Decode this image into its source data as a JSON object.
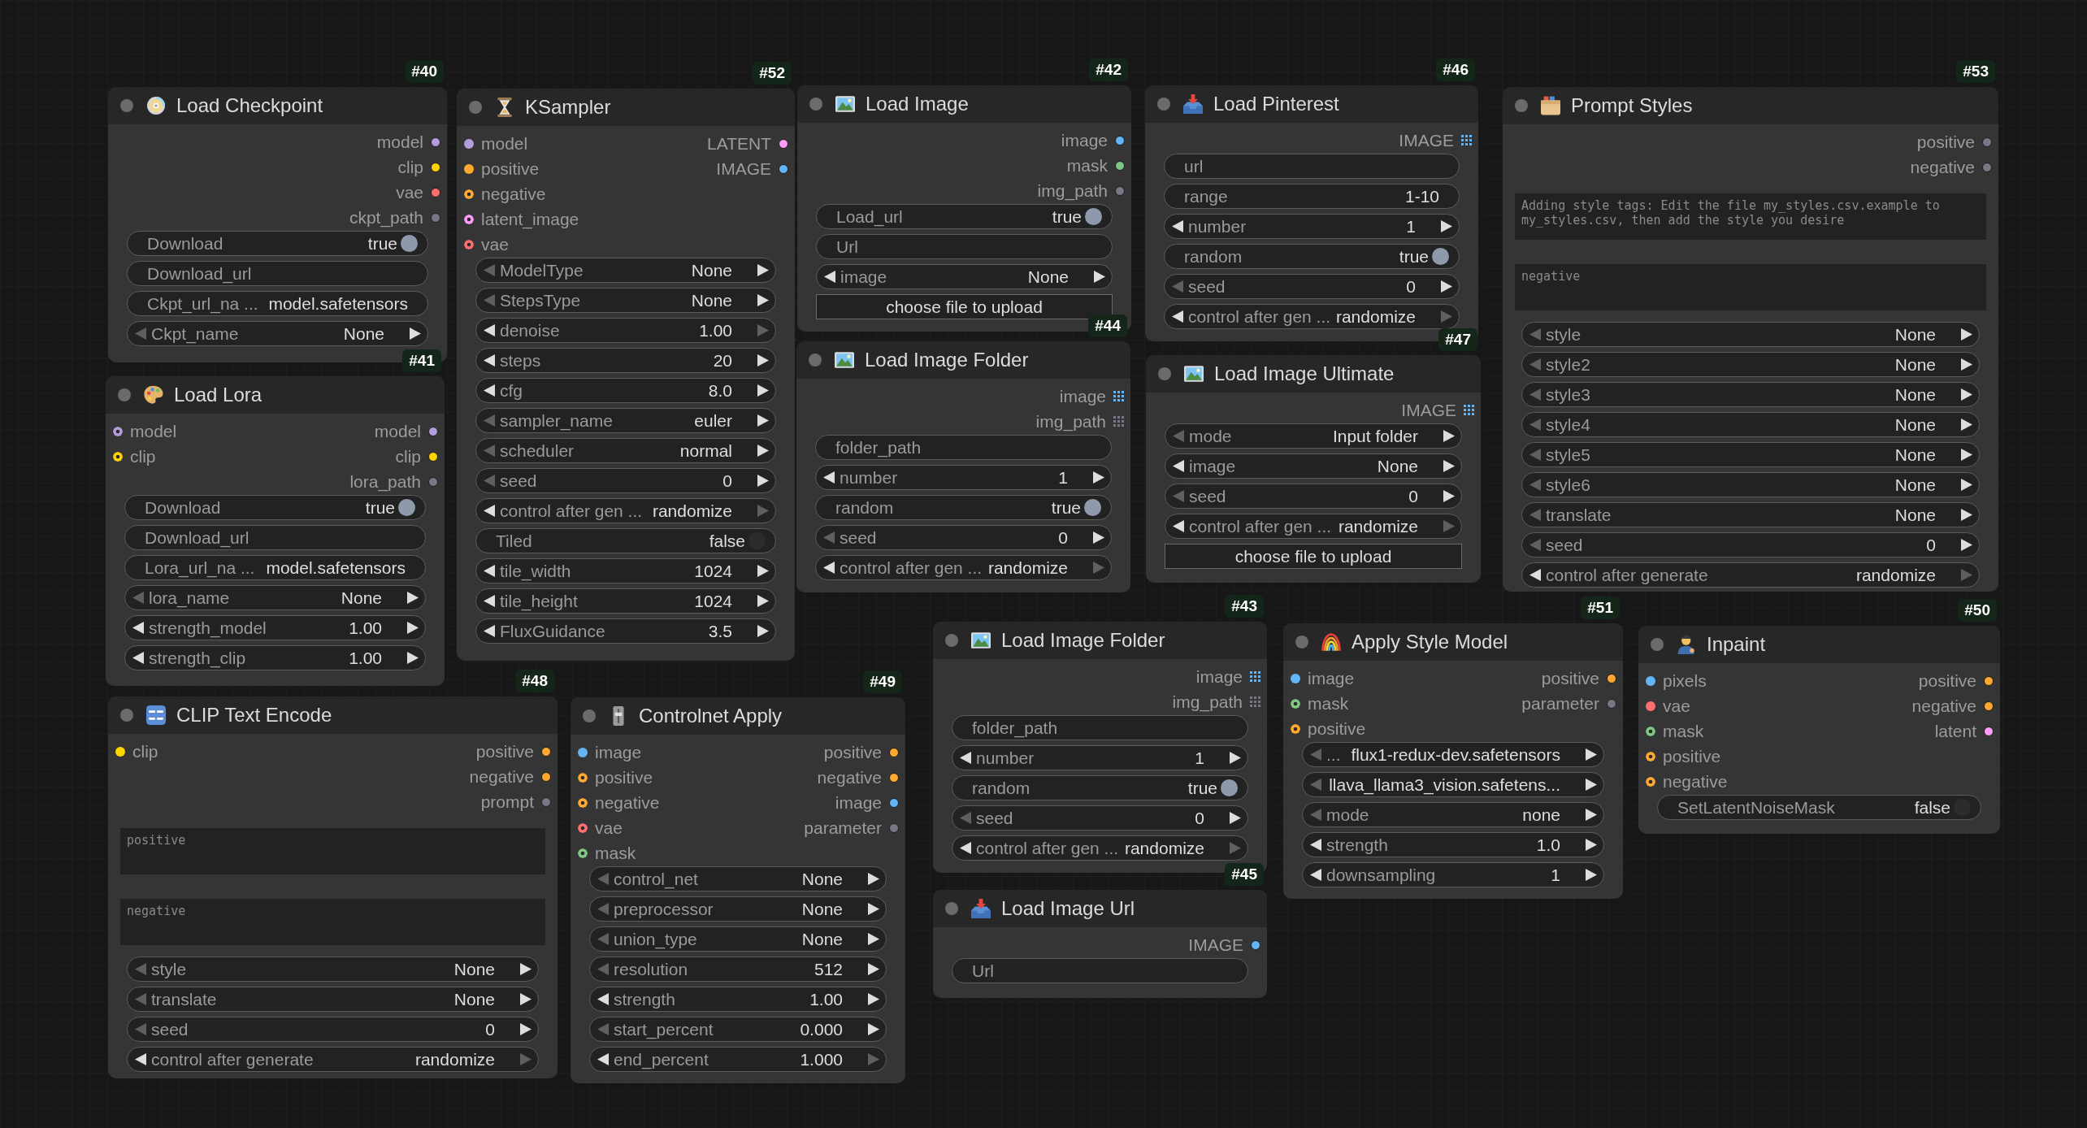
{
  "nodes": [
    {
      "badge": "#40",
      "title": "Load Checkpoint",
      "outputs": [
        {
          "label": "model",
          "kind": "dot",
          "color": "#b39ddb"
        },
        {
          "label": "clip",
          "kind": "dot",
          "color": "#ffd500"
        },
        {
          "label": "vae",
          "kind": "dot",
          "color": "#ff6e6e"
        },
        {
          "label": "ckpt_path",
          "kind": "dot",
          "color": "#777788"
        }
      ],
      "widgets": [
        {
          "kind": "toggle",
          "label": "Download",
          "value": "true",
          "on": true
        },
        {
          "kind": "text",
          "label": "Download_url"
        },
        {
          "kind": "text",
          "label": "Ckpt_url_na ...",
          "value": "model.safetensors"
        },
        {
          "kind": "combo",
          "label": "Ckpt_name",
          "value": "None",
          "left_disabled": true,
          "right_disabled": false
        }
      ]
    },
    {
      "badge": "#52",
      "title": "KSampler",
      "inputs": [
        {
          "label": "model",
          "kind": "dot",
          "color": "#b39ddb"
        },
        {
          "label": "positive",
          "kind": "dot",
          "color": "#ffa931"
        },
        {
          "label": "negative",
          "kind": "ring",
          "color": "#ffa931"
        },
        {
          "label": "latent_image",
          "kind": "ring",
          "color": "#ff9cf9"
        },
        {
          "label": "vae",
          "kind": "ring",
          "color": "#ff6e6e"
        }
      ],
      "outputs": [
        {
          "label": "LATENT",
          "kind": "dot",
          "color": "#ff9cf9"
        },
        {
          "label": "IMAGE",
          "kind": "dot",
          "color": "#64b5f6"
        }
      ],
      "widgets": [
        {
          "kind": "combo",
          "label": "ModelType",
          "value": "None",
          "left_disabled": true,
          "right_disabled": false
        },
        {
          "kind": "combo",
          "label": "StepsType",
          "value": "None",
          "left_disabled": true,
          "right_disabled": false
        },
        {
          "kind": "combo",
          "label": "denoise",
          "value": "1.00",
          "left_disabled": false,
          "right_disabled": true
        },
        {
          "kind": "combo",
          "label": "steps",
          "value": "20",
          "left_disabled": false,
          "right_disabled": false
        },
        {
          "kind": "combo",
          "label": "cfg",
          "value": "8.0",
          "left_disabled": false,
          "right_disabled": false
        },
        {
          "kind": "combo",
          "label": "sampler_name",
          "value": "euler",
          "left_disabled": true,
          "right_disabled": false
        },
        {
          "kind": "combo",
          "label": "scheduler",
          "value": "normal",
          "left_disabled": true,
          "right_disabled": false
        },
        {
          "kind": "combo",
          "label": "seed",
          "value": "0",
          "left_disabled": true,
          "right_disabled": false
        },
        {
          "kind": "combo",
          "label": "control after gen ...",
          "value": "randomize",
          "left_disabled": false,
          "right_disabled": true
        },
        {
          "kind": "toggle",
          "label": "Tiled",
          "value": "false",
          "on": false
        },
        {
          "kind": "combo",
          "label": "tile_width",
          "value": "1024",
          "left_disabled": false,
          "right_disabled": false
        },
        {
          "kind": "combo",
          "label": "tile_height",
          "value": "1024",
          "left_disabled": false,
          "right_disabled": false
        },
        {
          "kind": "combo",
          "label": "FluxGuidance",
          "value": "3.5",
          "left_disabled": false,
          "right_disabled": false
        }
      ]
    },
    {
      "badge": "#41",
      "title": "Load Lora",
      "inputs": [
        {
          "label": "model",
          "kind": "ring",
          "color": "#b39ddb"
        },
        {
          "label": "clip",
          "kind": "ring",
          "color": "#ffd500"
        }
      ],
      "outputs": [
        {
          "label": "model",
          "kind": "dot",
          "color": "#b39ddb"
        },
        {
          "label": "clip",
          "kind": "dot",
          "color": "#ffd500"
        },
        {
          "label": "lora_path",
          "kind": "dot",
          "color": "#777788"
        }
      ],
      "widgets": [
        {
          "kind": "toggle",
          "label": "Download",
          "value": "true",
          "on": true
        },
        {
          "kind": "text",
          "label": "Download_url"
        },
        {
          "kind": "text",
          "label": "Lora_url_na ...",
          "value": "model.safetensors"
        },
        {
          "kind": "combo",
          "label": "lora_name",
          "value": "None",
          "left_disabled": true,
          "right_disabled": false
        },
        {
          "kind": "combo",
          "label": "strength_model",
          "value": "1.00",
          "left_disabled": false,
          "right_disabled": false
        },
        {
          "kind": "combo",
          "label": "strength_clip",
          "value": "1.00",
          "left_disabled": false,
          "right_disabled": false
        }
      ]
    },
    {
      "badge": "#42",
      "title": "Load Image",
      "outputs": [
        {
          "label": "image",
          "kind": "dot",
          "color": "#64b5f6"
        },
        {
          "label": "mask",
          "kind": "dot",
          "color": "#81c784"
        },
        {
          "label": "img_path",
          "kind": "dot",
          "color": "#777788"
        }
      ],
      "widgets": [
        {
          "kind": "toggle",
          "label": "Load_url",
          "value": "true",
          "on": true
        },
        {
          "kind": "text",
          "label": "Url"
        },
        {
          "kind": "combo",
          "label": "image",
          "value": "None",
          "left_disabled": false,
          "right_disabled": false
        },
        {
          "kind": "button",
          "label": "choose file to upload"
        }
      ]
    },
    {
      "badge": "#44",
      "title": "Load Image Folder",
      "outputs": [
        {
          "label": "image",
          "kind": "grid",
          "color": "#64b5f6"
        },
        {
          "label": "img_path",
          "kind": "grid",
          "color": "#777788"
        }
      ],
      "widgets": [
        {
          "kind": "text",
          "label": "folder_path"
        },
        {
          "kind": "combo",
          "label": "number",
          "value": "1",
          "left_disabled": false,
          "right_disabled": false
        },
        {
          "kind": "toggle",
          "label": "random",
          "value": "true",
          "on": true
        },
        {
          "kind": "combo",
          "label": "seed",
          "value": "0",
          "left_disabled": true,
          "right_disabled": false
        },
        {
          "kind": "combo",
          "label": "control after gen ...",
          "value": "randomize",
          "left_disabled": false,
          "right_disabled": true
        }
      ]
    },
    {
      "badge": "#46",
      "title": "Load Pinterest",
      "outputs": [
        {
          "label": "IMAGE",
          "kind": "grid",
          "color": "#64b5f6"
        }
      ],
      "widgets": [
        {
          "kind": "text",
          "label": "url"
        },
        {
          "kind": "text",
          "label": "range",
          "value": "1-10"
        },
        {
          "kind": "combo",
          "label": "number",
          "value": "1",
          "left_disabled": false,
          "right_disabled": false
        },
        {
          "kind": "toggle",
          "label": "random",
          "value": "true",
          "on": true
        },
        {
          "kind": "combo",
          "label": "seed",
          "value": "0",
          "left_disabled": true,
          "right_disabled": false
        },
        {
          "kind": "combo",
          "label": "control after gen ...",
          "value": "randomize",
          "left_disabled": false,
          "right_disabled": true
        }
      ]
    },
    {
      "badge": "#47",
      "title": "Load Image Ultimate",
      "outputs": [
        {
          "label": "IMAGE",
          "kind": "grid",
          "color": "#64b5f6"
        }
      ],
      "widgets": [
        {
          "kind": "combo",
          "label": "mode",
          "value": "Input folder",
          "left_disabled": true,
          "right_disabled": false
        },
        {
          "kind": "combo",
          "label": "image",
          "value": "None",
          "left_disabled": false,
          "right_disabled": false
        },
        {
          "kind": "combo",
          "label": "seed",
          "value": "0",
          "left_disabled": true,
          "right_disabled": false
        },
        {
          "kind": "combo",
          "label": "control after gen ...",
          "value": "randomize",
          "left_disabled": false,
          "right_disabled": true
        },
        {
          "kind": "button",
          "label": "choose file to upload"
        }
      ]
    },
    {
      "badge": "#53",
      "title": "Prompt Styles",
      "outputs": [
        {
          "label": "positive",
          "kind": "dot",
          "color": "#777788"
        },
        {
          "label": "negative",
          "kind": "dot",
          "color": "#777788"
        }
      ],
      "widgets": [
        {
          "kind": "textarea",
          "placeholder": "Adding style tags: Edit the file my_styles.csv.example to my_styles.csv, then add the style you desire"
        },
        {
          "kind": "textarea",
          "placeholder": "negative"
        },
        {
          "kind": "combo",
          "label": "style",
          "value": "None",
          "left_disabled": true,
          "right_disabled": false
        },
        {
          "kind": "combo",
          "label": "style2",
          "value": "None",
          "left_disabled": true,
          "right_disabled": false
        },
        {
          "kind": "combo",
          "label": "style3",
          "value": "None",
          "left_disabled": true,
          "right_disabled": false
        },
        {
          "kind": "combo",
          "label": "style4",
          "value": "None",
          "left_disabled": true,
          "right_disabled": false
        },
        {
          "kind": "combo",
          "label": "style5",
          "value": "None",
          "left_disabled": true,
          "right_disabled": false
        },
        {
          "kind": "combo",
          "label": "style6",
          "value": "None",
          "left_disabled": true,
          "right_disabled": false
        },
        {
          "kind": "combo",
          "label": "translate",
          "value": "None",
          "left_disabled": true,
          "right_disabled": false
        },
        {
          "kind": "combo",
          "label": "seed",
          "value": "0",
          "left_disabled": true,
          "right_disabled": false
        },
        {
          "kind": "combo",
          "label": "control after generate",
          "value": "randomize",
          "left_disabled": false,
          "right_disabled": true
        }
      ]
    },
    {
      "badge": "#48",
      "title": "CLIP Text Encode",
      "inputs": [
        {
          "label": "clip",
          "kind": "dot",
          "color": "#ffd500"
        }
      ],
      "outputs": [
        {
          "label": "positive",
          "kind": "dot",
          "color": "#ffa931"
        },
        {
          "label": "negative",
          "kind": "dot",
          "color": "#ffa931"
        },
        {
          "label": "prompt",
          "kind": "dot",
          "color": "#777788"
        }
      ],
      "widgets": [
        {
          "kind": "textarea",
          "placeholder": "positive"
        },
        {
          "kind": "textarea",
          "placeholder": "negative"
        },
        {
          "kind": "combo",
          "label": "style",
          "value": "None",
          "left_disabled": true,
          "right_disabled": false
        },
        {
          "kind": "combo",
          "label": "translate",
          "value": "None",
          "left_disabled": true,
          "right_disabled": false
        },
        {
          "kind": "combo",
          "label": "seed",
          "value": "0",
          "left_disabled": true,
          "right_disabled": false
        },
        {
          "kind": "combo",
          "label": "control after generate",
          "value": "randomize",
          "left_disabled": false,
          "right_disabled": true
        }
      ]
    },
    {
      "badge": "#49",
      "title": "Controlnet Apply",
      "inputs": [
        {
          "label": "image",
          "kind": "dot",
          "color": "#64b5f6"
        },
        {
          "label": "positive",
          "kind": "ring",
          "color": "#ffa931"
        },
        {
          "label": "negative",
          "kind": "ring",
          "color": "#ffa931"
        },
        {
          "label": "vae",
          "kind": "ring",
          "color": "#ff6e6e"
        },
        {
          "label": "mask",
          "kind": "ring",
          "color": "#81c784"
        }
      ],
      "outputs": [
        {
          "label": "positive",
          "kind": "dot",
          "color": "#ffa931"
        },
        {
          "label": "negative",
          "kind": "dot",
          "color": "#ffa931"
        },
        {
          "label": "image",
          "kind": "dot",
          "color": "#64b5f6"
        },
        {
          "label": "parameter",
          "kind": "dot",
          "color": "#777788"
        }
      ],
      "widgets": [
        {
          "kind": "combo",
          "label": "control_net",
          "value": "None",
          "left_disabled": true,
          "right_disabled": false
        },
        {
          "kind": "combo",
          "label": "preprocessor",
          "value": "None",
          "left_disabled": true,
          "right_disabled": false
        },
        {
          "kind": "combo",
          "label": "union_type",
          "value": "None",
          "left_disabled": true,
          "right_disabled": false
        },
        {
          "kind": "combo",
          "label": "resolution",
          "value": "512",
          "left_disabled": true,
          "right_disabled": false
        },
        {
          "kind": "combo",
          "label": "strength",
          "value": "1.00",
          "left_disabled": false,
          "right_disabled": false
        },
        {
          "kind": "combo",
          "label": "start_percent",
          "value": "0.000",
          "left_disabled": true,
          "right_disabled": false
        },
        {
          "kind": "combo",
          "label": "end_percent",
          "value": "1.000",
          "left_disabled": false,
          "right_disabled": true
        }
      ]
    },
    {
      "badge": "#43",
      "title": "Load Image Folder",
      "outputs": [
        {
          "label": "image",
          "kind": "grid",
          "color": "#64b5f6"
        },
        {
          "label": "img_path",
          "kind": "grid",
          "color": "#777788"
        }
      ],
      "widgets": [
        {
          "kind": "text",
          "label": "folder_path"
        },
        {
          "kind": "combo",
          "label": "number",
          "value": "1",
          "left_disabled": false,
          "right_disabled": false
        },
        {
          "kind": "toggle",
          "label": "random",
          "value": "true",
          "on": true
        },
        {
          "kind": "combo",
          "label": "seed",
          "value": "0",
          "left_disabled": true,
          "right_disabled": false
        },
        {
          "kind": "combo",
          "label": "control after gen ...",
          "value": "randomize",
          "left_disabled": false,
          "right_disabled": true
        }
      ]
    },
    {
      "badge": "#45",
      "title": "Load Image Url",
      "outputs": [
        {
          "label": "IMAGE",
          "kind": "dot",
          "color": "#64b5f6"
        }
      ],
      "widgets": [
        {
          "kind": "text",
          "label": "Url"
        }
      ]
    },
    {
      "badge": "#51",
      "title": "Apply Style Model",
      "inputs": [
        {
          "label": "image",
          "kind": "dot",
          "color": "#64b5f6"
        },
        {
          "label": "mask",
          "kind": "ring",
          "color": "#81c784"
        },
        {
          "label": "positive",
          "kind": "ring",
          "color": "#ffa931"
        }
      ],
      "outputs": [
        {
          "label": "positive",
          "kind": "dot",
          "color": "#ffa931"
        },
        {
          "label": "parameter",
          "kind": "dot",
          "color": "#777788"
        }
      ],
      "widgets": [
        {
          "kind": "combo",
          "label": "...",
          "value": "flux1-redux-dev.safetensors",
          "left_disabled": true,
          "right_disabled": false
        },
        {
          "kind": "combo",
          "value": "llava_llama3_vision.safetens...",
          "left_disabled": true,
          "right_disabled": false
        },
        {
          "kind": "combo",
          "label": "mode",
          "value": "none",
          "left_disabled": true,
          "right_disabled": false
        },
        {
          "kind": "combo",
          "label": "strength",
          "value": "1.0",
          "left_disabled": false,
          "right_disabled": false
        },
        {
          "kind": "combo",
          "label": "downsampling",
          "value": "1",
          "left_disabled": false,
          "right_disabled": false
        }
      ]
    },
    {
      "badge": "#50",
      "title": "Inpaint",
      "inputs": [
        {
          "label": "pixels",
          "kind": "dot",
          "color": "#64b5f6"
        },
        {
          "label": "vae",
          "kind": "dot",
          "color": "#ff6e6e"
        },
        {
          "label": "mask",
          "kind": "ring",
          "color": "#81c784"
        },
        {
          "label": "positive",
          "kind": "ring",
          "color": "#ffa931"
        },
        {
          "label": "negative",
          "kind": "ring",
          "color": "#ffa931"
        }
      ],
      "outputs": [
        {
          "label": "positive",
          "kind": "dot",
          "color": "#ffa931"
        },
        {
          "label": "negative",
          "kind": "dot",
          "color": "#ffa931"
        },
        {
          "label": "latent",
          "kind": "dot",
          "color": "#ff9cf9"
        }
      ],
      "widgets": [
        {
          "kind": "toggle",
          "label": "SetLatentNoiseMask",
          "value": "false",
          "on": false
        }
      ]
    }
  ]
}
